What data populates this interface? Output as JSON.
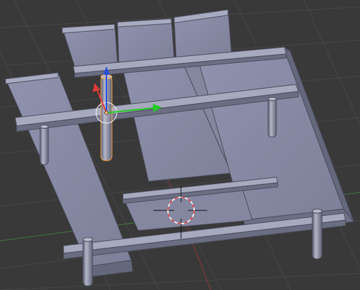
{
  "viewport": {
    "background_color": "#393939",
    "grid_line_color": "#474747",
    "x_axis_color": "#8e3a3a",
    "y_axis_color": "#3f7a3f",
    "mesh_top_color": "#8a8ca8",
    "mesh_side_color": "#65677c",
    "mesh_edge_color": "#4b4c5c",
    "selection_outline_color": "#f2a23a",
    "gizmo_x_color": "#e23a3a",
    "gizmo_y_color": "#22cc22",
    "gizmo_z_color": "#2c4fe6",
    "cursor_ring_colors": [
      "#e04040",
      "#ffffff"
    ]
  },
  "scene": {
    "objects": [
      {
        "name": "table-planks",
        "kind": "mesh",
        "selected": false
      },
      {
        "name": "crossbeams",
        "kind": "mesh",
        "selected": false
      },
      {
        "name": "legs",
        "kind": "mesh",
        "selected": false
      },
      {
        "name": "selected-cylinder",
        "kind": "mesh",
        "selected": true
      }
    ],
    "gizmo": {
      "mode": "translate",
      "axes": [
        "x",
        "y",
        "z"
      ],
      "icon": "translate-gizmo-icon"
    },
    "cursor": {
      "icon": "3d-cursor-icon"
    }
  }
}
